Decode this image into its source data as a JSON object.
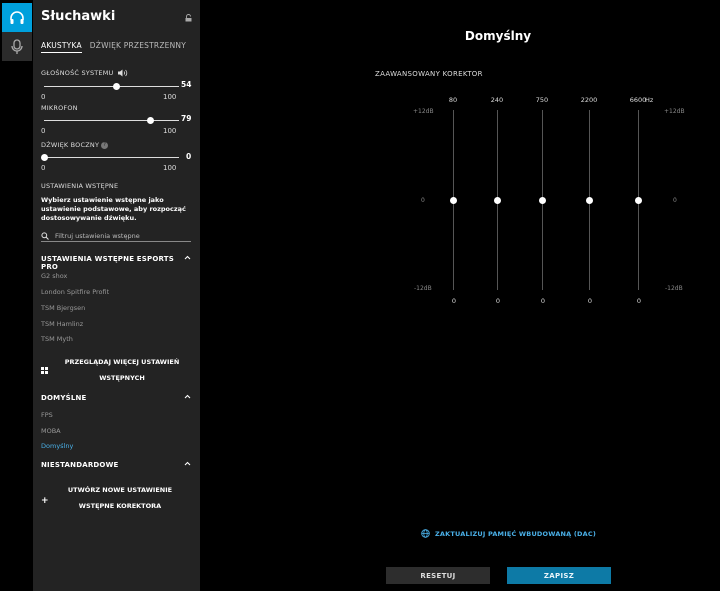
{
  "sidebar": {
    "title": "Słuchawki",
    "tabs": [
      {
        "label": "AKUSTYKA",
        "active": true
      },
      {
        "label": "DŹWIĘK PRZESTRZENNY",
        "active": false
      }
    ],
    "system_volume": {
      "label": "GŁOŚNOŚĆ SYSTEMU",
      "value": "54",
      "min": "0",
      "max": "100",
      "fraction": 0.54
    },
    "microphone": {
      "label": "MIKROFON",
      "value": "79",
      "min": "0",
      "max": "100",
      "fraction": 0.79
    },
    "sidetone": {
      "label": "DŹWIĘK BOCZNY",
      "help": "?",
      "value": "0",
      "min": "0",
      "max": "100",
      "fraction": 0.0
    },
    "presets_label": "USTAWIENIA WSTĘPNE",
    "presets_description": "Wybierz ustawienie wstępne jako ustawienie podstawowe, aby rozpocząć dostosowywanie dźwięku.",
    "search_placeholder": "Filtruj ustawienia wstępne",
    "esports_section": {
      "title": "USTAWIENIA WSTĘPNE ESPORTS PRO",
      "items": [
        "G2 shox",
        "London Spitfire Profit",
        "TSM Bjergsen",
        "TSM Hamlinz",
        "TSM Myth"
      ]
    },
    "browse_more": "PRZEGLĄDAJ WIĘCEJ USTAWIEŃ WSTĘPNYCH",
    "default_section": {
      "title": "DOMYŚLNE",
      "items": [
        "FPS",
        "MOBA",
        "Domyślny"
      ],
      "selected": "Domyślny"
    },
    "custom_section": {
      "title": "NIESTANDARDOWE"
    },
    "create_new": "UTWÓRZ NOWE USTAWIENIE WSTĘPNE KOREKTORA"
  },
  "main": {
    "title": "Domyślny",
    "eq_title": "ZAAWANSOWANY KOREKTOR",
    "db_top": "+12dB",
    "db_mid": "0",
    "db_bottom": "-12dB",
    "hz_unit": "Hz",
    "bands": [
      {
        "freq": "80",
        "value": "0"
      },
      {
        "freq": "240",
        "value": "0"
      },
      {
        "freq": "750",
        "value": "0"
      },
      {
        "freq": "2200",
        "value": "0"
      },
      {
        "freq": "6600",
        "value": "0"
      }
    ],
    "update_memory": "ZAKTUALIZUJ PAMIĘĆ WBUDOWANĄ (DAC)",
    "reset_label": "RESETUJ",
    "save_label": "ZAPISZ"
  },
  "colors": {
    "accent": "#00a0dc",
    "selected_text": "#4ab0e8",
    "save_button": "#0d7aa6",
    "panel_bg": "#232323"
  }
}
